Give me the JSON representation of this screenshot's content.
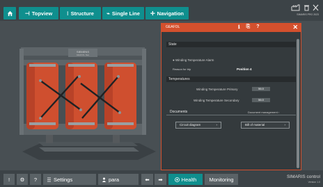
{
  "topbar": {
    "home_icon": "home-icon",
    "buttons": [
      {
        "icon": "⊣",
        "label": "Topview"
      },
      {
        "icon": "⁝",
        "label": "Structure"
      },
      {
        "icon": "⌁",
        "label": "Single Line"
      },
      {
        "icon": "✛",
        "label": "Navigation"
      }
    ],
    "right_small_text": "SIMARIS PRO 2023"
  },
  "transformer": {
    "brand_plate": "SIEMENS",
    "plate_sub": "GEAFOL Neo"
  },
  "dialog": {
    "title": "GEAFOL",
    "header_icons": [
      "ℹ",
      "⎘",
      "?"
    ],
    "close": "✕",
    "state_section": "State",
    "state_radio_label": "Winding Temperature Alarm",
    "reason_label": "Reason for trip",
    "reason_value": "Position 4",
    "temperatures_section": "Temperatures",
    "temp_primary_label": "Winding Temperature Primary",
    "temp_primary_value": "56.0",
    "temp_secondary_label": "Winding Temperature Secondary",
    "temp_secondary_value": "56.0",
    "documents_section": "Documents",
    "document_management": "Document management ›",
    "circuit_diagram": "Circuit diagram",
    "bill_of_material": "Bill of material",
    "chevron": "›"
  },
  "bottombar": {
    "alert_icon": "!",
    "settings_icon": "⚙",
    "help_icon": "?",
    "settings_label": "Settings",
    "user_label": "para",
    "back_icon": "⬅",
    "forward_icon": "➡",
    "health_label": "Health",
    "monitoring_label": "Monitoring",
    "brand": "SIMARIS control",
    "brand_sub": "Version 1.0"
  },
  "colors": {
    "accent_teal": "#0f8f8e",
    "dialog_accent": "#d4502d",
    "coil_orange": "#d65533"
  }
}
